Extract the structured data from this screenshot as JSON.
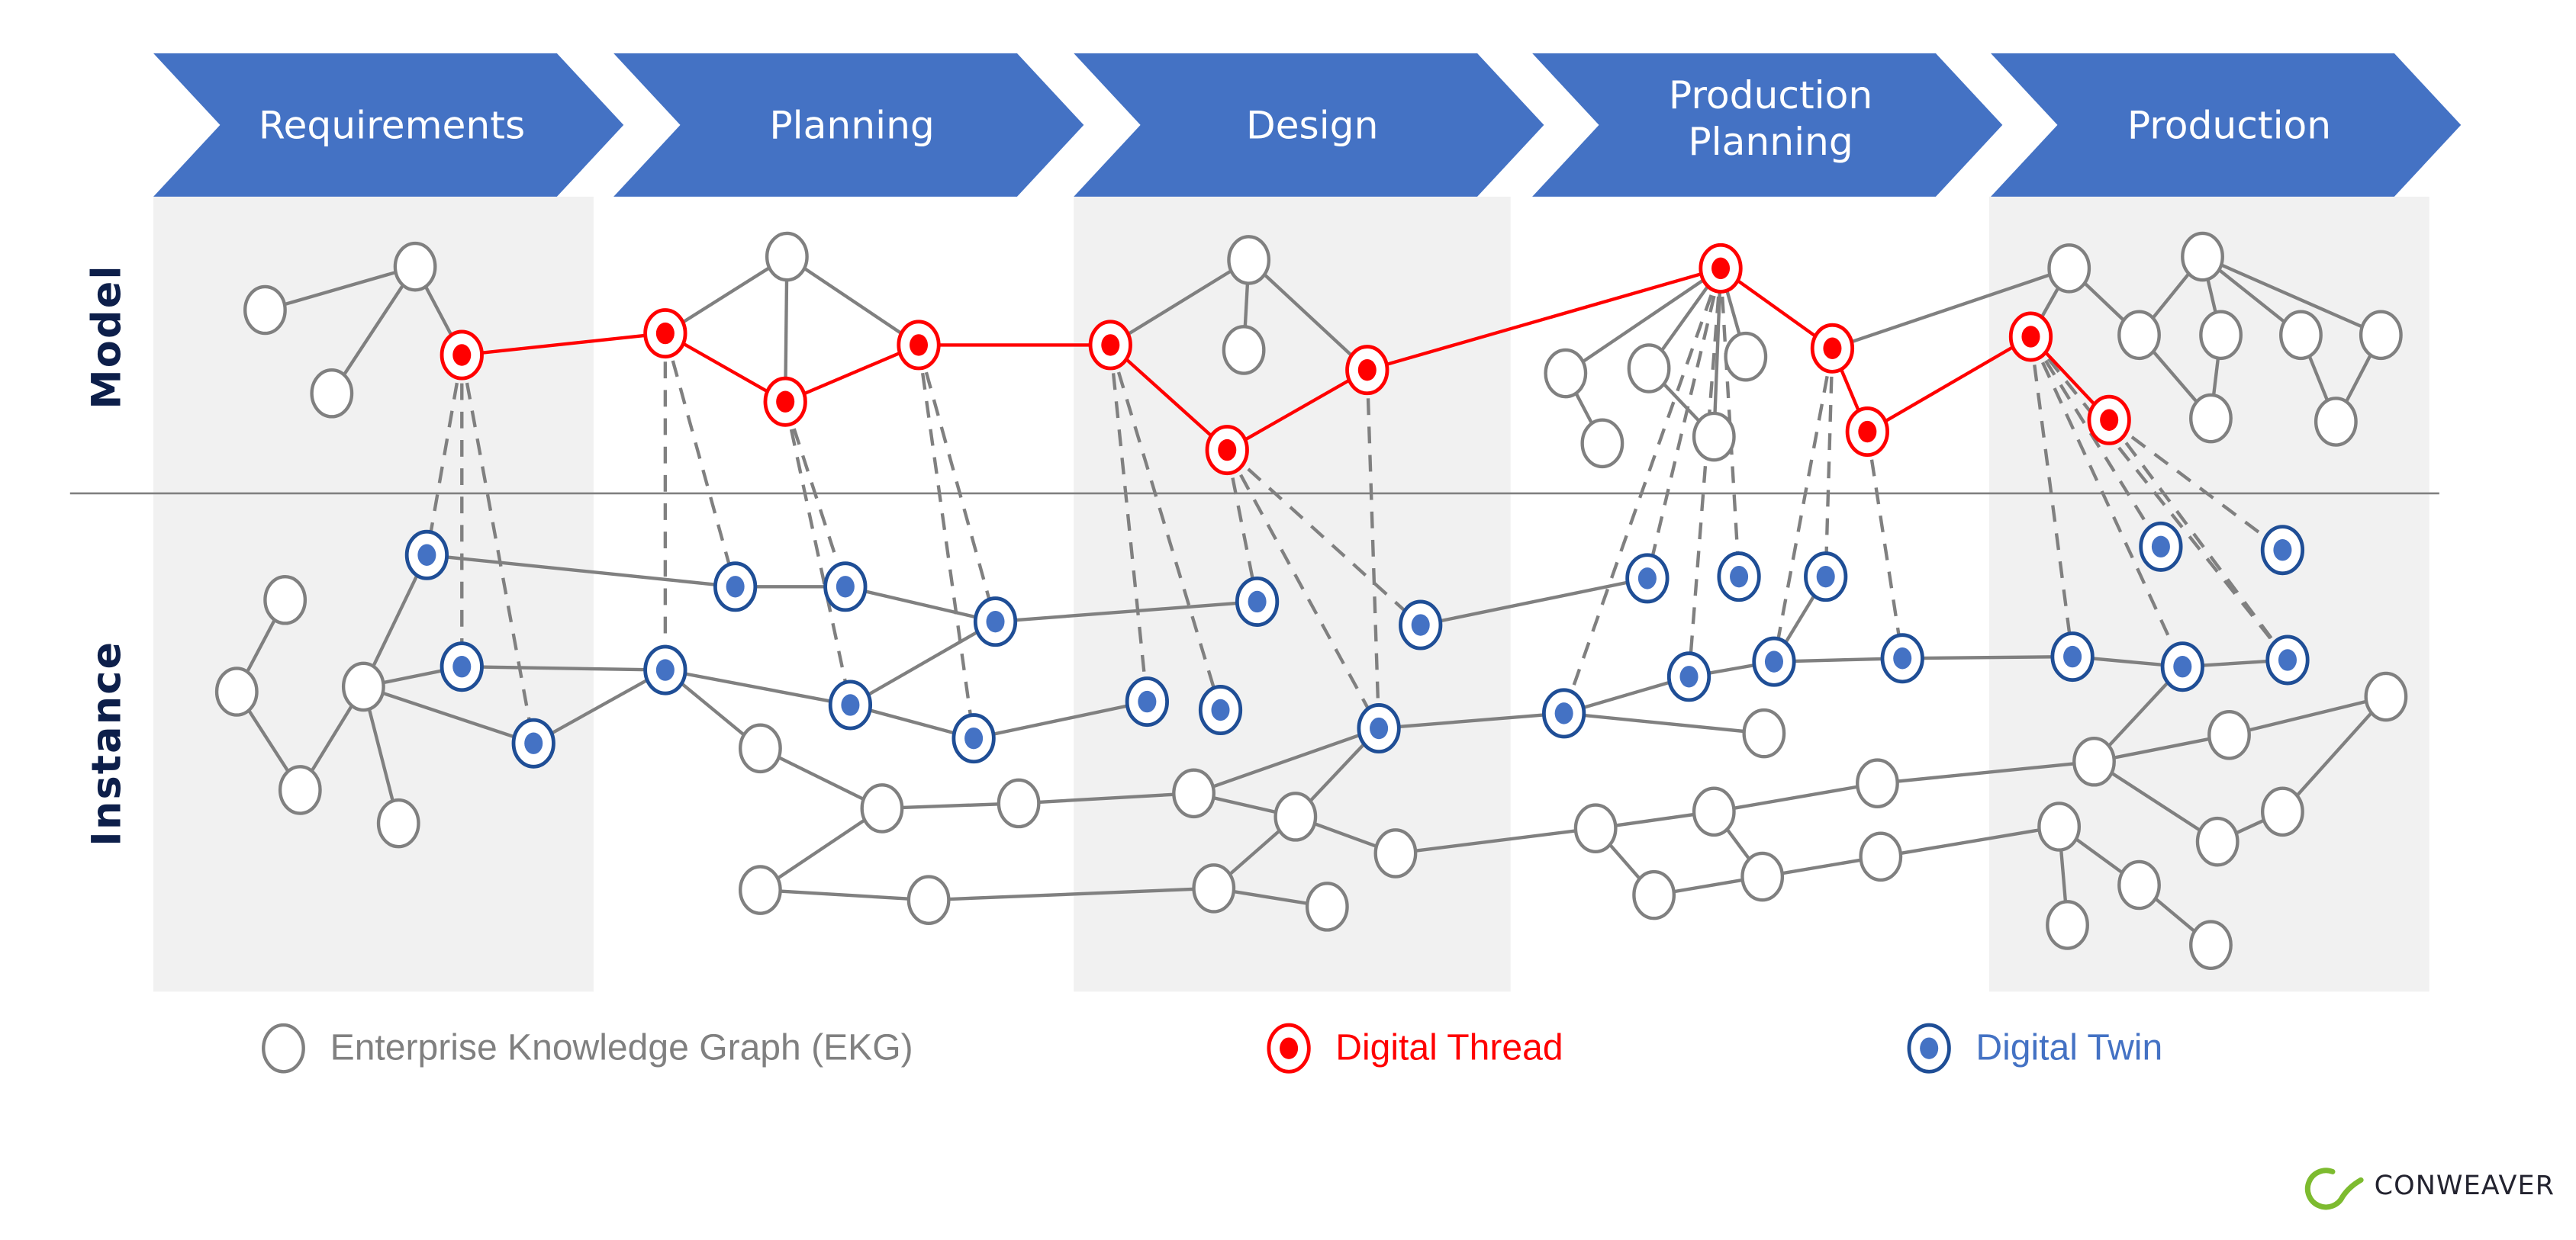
{
  "phases": [
    {
      "id": "requirements",
      "lines": [
        "Requirements"
      ]
    },
    {
      "id": "planning",
      "lines": [
        "Planning"
      ]
    },
    {
      "id": "design",
      "lines": [
        "Design"
      ]
    },
    {
      "id": "production-planning",
      "lines": [
        "Production",
        "Planning"
      ]
    },
    {
      "id": "production",
      "lines": [
        "Production"
      ]
    }
  ],
  "layers": {
    "model_label": "Model",
    "instance_label": "Instance"
  },
  "legend": [
    {
      "id": "ekg",
      "type": "ekg",
      "label": "Enterprise Knowledge Graph (EKG)"
    },
    {
      "id": "thread",
      "type": "thread",
      "label": "Digital Thread"
    },
    {
      "id": "twin",
      "type": "twin",
      "label": "Digital Twin"
    }
  ],
  "logo": {
    "name": "CONWEAVER"
  },
  "colors": {
    "phase_fill": "#4472c4",
    "band_fill": "#f1f1f1",
    "ekg_stroke": "#808080",
    "thread": "#ff0000",
    "twin_ring": "#1f4e96",
    "twin_dot": "#4472c4",
    "axis_label": "#0d1f4a",
    "logo_green": "#7dbb2f",
    "logo_text": "#23232f"
  },
  "graph": {
    "model_nodes": [
      {
        "id": "m1",
        "type": "ekg"
      },
      {
        "id": "m2",
        "type": "ekg"
      },
      {
        "id": "m3",
        "type": "ekg"
      },
      {
        "id": "t1",
        "type": "thread"
      },
      {
        "id": "t2",
        "type": "thread"
      },
      {
        "id": "m4",
        "type": "ekg"
      },
      {
        "id": "t3",
        "type": "thread"
      },
      {
        "id": "t4",
        "type": "thread"
      },
      {
        "id": "t5",
        "type": "thread"
      },
      {
        "id": "m5",
        "type": "ekg"
      },
      {
        "id": "m6",
        "type": "ekg"
      },
      {
        "id": "t6",
        "type": "thread"
      },
      {
        "id": "t7",
        "type": "thread"
      },
      {
        "id": "t8",
        "type": "thread"
      },
      {
        "id": "m7",
        "type": "ekg"
      },
      {
        "id": "m8",
        "type": "ekg"
      },
      {
        "id": "m9",
        "type": "ekg"
      },
      {
        "id": "m10",
        "type": "ekg"
      },
      {
        "id": "m11",
        "type": "ekg"
      },
      {
        "id": "t9",
        "type": "thread"
      },
      {
        "id": "t10",
        "type": "thread"
      },
      {
        "id": "t11",
        "type": "thread"
      },
      {
        "id": "t12",
        "type": "thread"
      },
      {
        "id": "m12",
        "type": "ekg"
      },
      {
        "id": "m13",
        "type": "ekg"
      },
      {
        "id": "m14",
        "type": "ekg"
      },
      {
        "id": "m15",
        "type": "ekg"
      },
      {
        "id": "m16",
        "type": "ekg"
      },
      {
        "id": "m17",
        "type": "ekg"
      },
      {
        "id": "m18",
        "type": "ekg"
      },
      {
        "id": "m19",
        "type": "ekg"
      }
    ],
    "instance_nodes": [
      {
        "id": "i1",
        "type": "ekg"
      },
      {
        "id": "i2",
        "type": "ekg"
      },
      {
        "id": "i3",
        "type": "ekg"
      },
      {
        "id": "i4",
        "type": "ekg"
      },
      {
        "id": "i5",
        "type": "ekg"
      },
      {
        "id": "d1",
        "type": "twin"
      },
      {
        "id": "d2",
        "type": "twin"
      },
      {
        "id": "d3",
        "type": "twin"
      },
      {
        "id": "d4",
        "type": "twin"
      },
      {
        "id": "d5",
        "type": "twin"
      },
      {
        "id": "d6",
        "type": "twin"
      },
      {
        "id": "d7",
        "type": "twin"
      },
      {
        "id": "d8",
        "type": "twin"
      },
      {
        "id": "d9",
        "type": "twin"
      },
      {
        "id": "i6",
        "type": "ekg"
      },
      {
        "id": "i7",
        "type": "ekg"
      },
      {
        "id": "i8",
        "type": "ekg"
      },
      {
        "id": "i9",
        "type": "ekg"
      },
      {
        "id": "i10",
        "type": "ekg"
      },
      {
        "id": "d10",
        "type": "twin"
      },
      {
        "id": "d11",
        "type": "twin"
      },
      {
        "id": "d12",
        "type": "twin"
      },
      {
        "id": "d13",
        "type": "twin"
      },
      {
        "id": "d14",
        "type": "twin"
      },
      {
        "id": "i11",
        "type": "ekg"
      },
      {
        "id": "i12",
        "type": "ekg"
      },
      {
        "id": "i13",
        "type": "ekg"
      },
      {
        "id": "i14",
        "type": "ekg"
      },
      {
        "id": "d15",
        "type": "twin"
      },
      {
        "id": "d16",
        "type": "twin"
      },
      {
        "id": "d17",
        "type": "twin"
      },
      {
        "id": "d18",
        "type": "twin"
      },
      {
        "id": "d19",
        "type": "twin"
      },
      {
        "id": "d20",
        "type": "twin"
      },
      {
        "id": "d21",
        "type": "twin"
      },
      {
        "id": "i15",
        "type": "ekg"
      },
      {
        "id": "i16",
        "type": "ekg"
      },
      {
        "id": "i17",
        "type": "ekg"
      },
      {
        "id": "i18",
        "type": "ekg"
      },
      {
        "id": "i19",
        "type": "ekg"
      },
      {
        "id": "i20",
        "type": "ekg"
      },
      {
        "id": "i21",
        "type": "ekg"
      },
      {
        "id": "d22",
        "type": "twin"
      },
      {
        "id": "d23",
        "type": "twin"
      },
      {
        "id": "d24",
        "type": "twin"
      },
      {
        "id": "d25",
        "type": "twin"
      },
      {
        "id": "d26",
        "type": "twin"
      },
      {
        "id": "i22",
        "type": "ekg"
      },
      {
        "id": "i23",
        "type": "ekg"
      },
      {
        "id": "i24",
        "type": "ekg"
      },
      {
        "id": "i25",
        "type": "ekg"
      },
      {
        "id": "i26",
        "type": "ekg"
      },
      {
        "id": "i27",
        "type": "ekg"
      },
      {
        "id": "i28",
        "type": "ekg"
      },
      {
        "id": "i29",
        "type": "ekg"
      },
      {
        "id": "i30",
        "type": "ekg"
      }
    ],
    "model_edges": [
      [
        "m1",
        "m2"
      ],
      [
        "m2",
        "m3"
      ],
      [
        "m2",
        "t1"
      ],
      [
        "t2",
        "m4"
      ],
      [
        "m4",
        "t4"
      ],
      [
        "m4",
        "t3"
      ],
      [
        "t5",
        "m5"
      ],
      [
        "m5",
        "m6"
      ],
      [
        "m5",
        "t7"
      ],
      [
        "t8",
        "m7"
      ],
      [
        "t8",
        "m8"
      ],
      [
        "t8",
        "m9"
      ],
      [
        "m7",
        "m10"
      ],
      [
        "m8",
        "m11"
      ],
      [
        "t8",
        "m11"
      ],
      [
        "t9",
        "m12"
      ],
      [
        "m12",
        "t11"
      ],
      [
        "m12",
        "m14"
      ],
      [
        "m13",
        "m14"
      ],
      [
        "m13",
        "m15"
      ],
      [
        "m13",
        "m16"
      ],
      [
        "m13",
        "m17"
      ],
      [
        "m14",
        "m18"
      ],
      [
        "m15",
        "m18"
      ],
      [
        "m16",
        "m19"
      ],
      [
        "m17",
        "m19"
      ]
    ],
    "thread_edges": [
      [
        "t1",
        "t2"
      ],
      [
        "t2",
        "t3"
      ],
      [
        "t3",
        "t4"
      ],
      [
        "t4",
        "t5"
      ],
      [
        "t5",
        "t6"
      ],
      [
        "t6",
        "t7"
      ],
      [
        "t7",
        "t8"
      ],
      [
        "t8",
        "t9"
      ],
      [
        "t9",
        "t10"
      ],
      [
        "t10",
        "t11"
      ],
      [
        "t11",
        "t12"
      ]
    ],
    "instance_edges": [
      [
        "i1",
        "i2"
      ],
      [
        "i2",
        "i3"
      ],
      [
        "i4",
        "d1"
      ],
      [
        "i4",
        "d2"
      ],
      [
        "i4",
        "d3"
      ],
      [
        "i4",
        "i3"
      ],
      [
        "i4",
        "i5"
      ],
      [
        "d1",
        "d4"
      ],
      [
        "d4",
        "d5"
      ],
      [
        "d5",
        "d6"
      ],
      [
        "d2",
        "d7"
      ],
      [
        "d7",
        "d3"
      ],
      [
        "d3",
        "i7"
      ],
      [
        "i7",
        "i8"
      ],
      [
        "i8",
        "i9"
      ],
      [
        "i7",
        "i6"
      ],
      [
        "d7",
        "d8"
      ],
      [
        "d7",
        "i6"
      ],
      [
        "d8",
        "d6"
      ],
      [
        "d8",
        "d9"
      ],
      [
        "d6",
        "d10"
      ],
      [
        "d9",
        "d11"
      ],
      [
        "i6",
        "i8"
      ],
      [
        "i9",
        "i10"
      ],
      [
        "i10",
        "i11"
      ],
      [
        "i10",
        "d14"
      ],
      [
        "i11",
        "d14"
      ],
      [
        "i11",
        "i12"
      ],
      [
        "i12",
        "i13"
      ],
      [
        "i12",
        "i14"
      ],
      [
        "d14",
        "d15"
      ],
      [
        "d13",
        "d14"
      ],
      [
        "d15",
        "d16"
      ],
      [
        "d15",
        "i15"
      ],
      [
        "d16",
        "d17"
      ],
      [
        "d17",
        "d18"
      ],
      [
        "d18",
        "d19"
      ],
      [
        "d19",
        "d20"
      ],
      [
        "d20",
        "d21"
      ],
      [
        "d12",
        "d16"
      ],
      [
        "d13",
        "d22"
      ],
      [
        "i14",
        "i16"
      ],
      [
        "i16",
        "i17"
      ],
      [
        "i17",
        "i18"
      ],
      [
        "i18",
        "i19"
      ],
      [
        "i19",
        "i22"
      ],
      [
        "i19",
        "i20"
      ],
      [
        "i20",
        "i21"
      ],
      [
        "i21",
        "i22"
      ],
      [
        "i16",
        "i23"
      ],
      [
        "i23",
        "i24"
      ],
      [
        "i24",
        "i25"
      ],
      [
        "i25",
        "i26"
      ],
      [
        "i26",
        "i27"
      ],
      [
        "i26",
        "i28"
      ],
      [
        "i27",
        "i29"
      ],
      [
        "i19",
        "i30"
      ],
      [
        "i30",
        "i20"
      ],
      [
        "d20",
        "i19"
      ]
    ],
    "links": [
      [
        "t1",
        "d1"
      ],
      [
        "t1",
        "d2"
      ],
      [
        "t1",
        "d3"
      ],
      [
        "t2",
        "d7"
      ],
      [
        "t2",
        "d4"
      ],
      [
        "t3",
        "d8"
      ],
      [
        "t3",
        "d5"
      ],
      [
        "t4",
        "d9"
      ],
      [
        "t4",
        "d6"
      ],
      [
        "t5",
        "d11"
      ],
      [
        "t5",
        "d12"
      ],
      [
        "t6",
        "d13"
      ],
      [
        "t6",
        "d10"
      ],
      [
        "t6",
        "d14"
      ],
      [
        "t7",
        "d14"
      ],
      [
        "t8",
        "d15"
      ],
      [
        "t8",
        "d16"
      ],
      [
        "t8",
        "d22"
      ],
      [
        "t8",
        "d23"
      ],
      [
        "t8",
        "d24"
      ],
      [
        "t9",
        "d17"
      ],
      [
        "t9",
        "d25"
      ],
      [
        "t10",
        "d18"
      ],
      [
        "t10",
        "d26"
      ],
      [
        "t11",
        "d19"
      ],
      [
        "t11",
        "d20"
      ],
      [
        "t11",
        "d21"
      ],
      [
        "t12",
        "d21"
      ],
      [
        "t12",
        "d26b"
      ]
    ]
  }
}
